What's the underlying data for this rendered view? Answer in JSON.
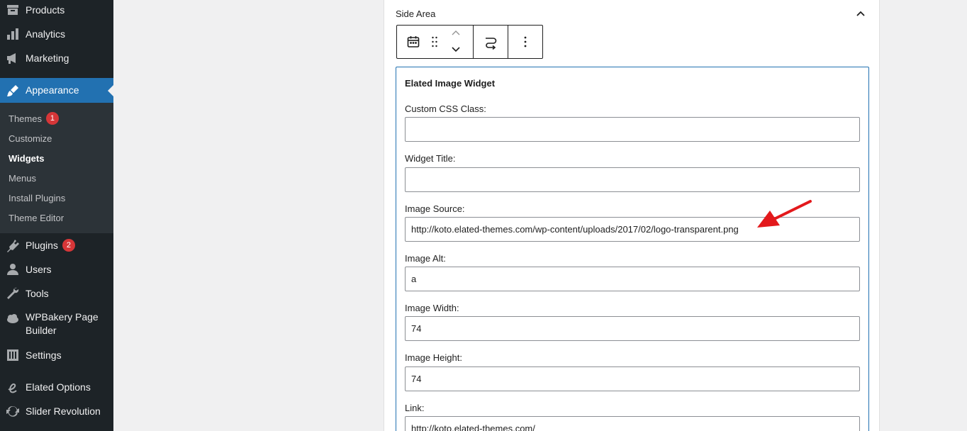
{
  "sidebar": {
    "items_top": [
      {
        "label": "Products",
        "icon": "archive-icon"
      },
      {
        "label": "Analytics",
        "icon": "bar-chart-icon"
      },
      {
        "label": "Marketing",
        "icon": "megaphone-icon"
      }
    ],
    "active": {
      "label": "Appearance",
      "icon": "brush-icon"
    },
    "submenu": [
      {
        "label": "Themes",
        "badge": "1"
      },
      {
        "label": "Customize"
      },
      {
        "label": "Widgets"
      },
      {
        "label": "Menus"
      },
      {
        "label": "Install Plugins"
      },
      {
        "label": "Theme Editor"
      }
    ],
    "items_bottom": [
      {
        "label": "Plugins",
        "badge": "2",
        "icon": "plug-icon"
      },
      {
        "label": "Users",
        "icon": "user-icon"
      },
      {
        "label": "Tools",
        "icon": "wrench-icon"
      },
      {
        "label": "WPBakery Page Builder",
        "icon": "cloud-icon"
      },
      {
        "label": "Settings",
        "icon": "sliders-icon"
      },
      {
        "label": "Elated Options",
        "icon": "elated-logo-icon"
      },
      {
        "label": "Slider Revolution",
        "icon": "refresh-icon"
      }
    ]
  },
  "panel": {
    "title": "Side Area",
    "widget": {
      "title": "Elated Image Widget",
      "fields": [
        {
          "label": "Custom CSS Class:",
          "value": ""
        },
        {
          "label": "Widget Title:",
          "value": ""
        },
        {
          "label": "Image Source:",
          "value": "http://koto.elated-themes.com/wp-content/uploads/2017/02/logo-transparent.png"
        },
        {
          "label": "Image Alt:",
          "value": "a"
        },
        {
          "label": "Image Width:",
          "value": "74"
        },
        {
          "label": "Image Height:",
          "value": "74"
        },
        {
          "label": "Link:",
          "value": "http://koto.elated-themes.com/"
        }
      ]
    }
  },
  "colors": {
    "sidebar_bg": "#1d2327",
    "submenu_bg": "#2c3338",
    "accent": "#2271b1",
    "badge": "#d63638",
    "annotation": "#e3191c"
  }
}
